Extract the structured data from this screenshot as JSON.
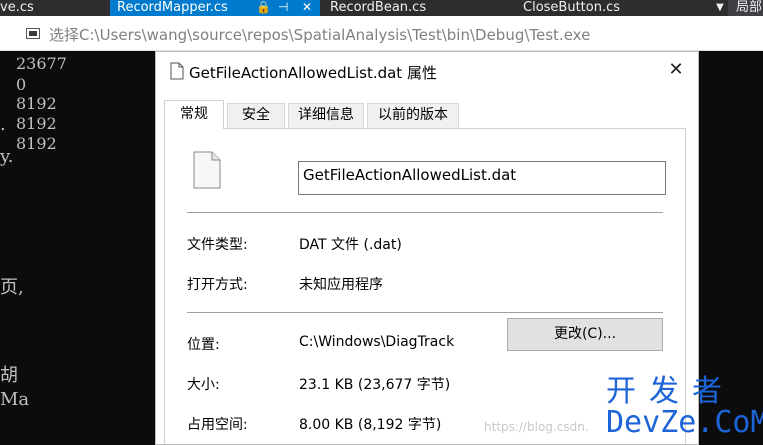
{
  "vs_tabs": [
    {
      "label": "ve.cs",
      "active": false
    },
    {
      "label": "RecordMapper.cs",
      "active": true
    },
    {
      "label": "RecordBean.cs",
      "active": false
    },
    {
      "label": "CloseButton.cs",
      "active": false
    }
  ],
  "vs_extra_tab": "局部",
  "console": {
    "title": "选择C:\\Users\\wang\\source\\repos\\SpatialAnalysis\\Test\\bin\\Debug\\Test.exe",
    "lines": [
      "23677",
      "0",
      "8192",
      "8192",
      "8192"
    ],
    "left_fragments": [
      ".",
      ".",
      "y.",
      "页,",
      "胡",
      "Ma"
    ]
  },
  "dialog": {
    "title": "GetFileActionAllowedList.dat 属性",
    "tabs": [
      {
        "label": "常规",
        "active": true
      },
      {
        "label": "安全",
        "active": false
      },
      {
        "label": "详细信息",
        "active": false
      },
      {
        "label": "以前的版本",
        "active": false
      }
    ],
    "file_name": "GetFileActionAllowedList.dat",
    "file_type": {
      "label": "文件类型:",
      "value": "DAT 文件 (.dat)"
    },
    "opens_with": {
      "label": "打开方式:",
      "value": "未知应用程序",
      "button": "更改(C)..."
    },
    "location": {
      "label": "位置:",
      "value": "C:\\Windows\\DiagTrack"
    },
    "size": {
      "label": "大小:",
      "value": "23.1 KB (23,677 字节)"
    },
    "size_on_disk": {
      "label": "占用空间:",
      "value": "8.00 KB (8,192 字节)"
    }
  },
  "watermarks": {
    "csdn": "https://blog.csdn.",
    "brand_top": "开发者",
    "brand_bottom": "DevZe.CoM"
  },
  "colors": {
    "vs_accent": "#007acc",
    "brand_blue": "#1c64d8"
  }
}
